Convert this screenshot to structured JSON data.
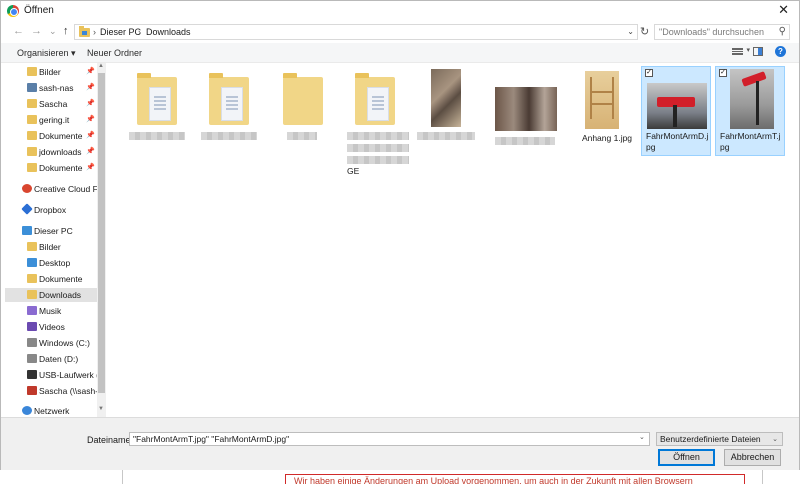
{
  "window": {
    "title": "Öffnen",
    "close_label": "✕"
  },
  "nav": {
    "back": "←",
    "forward": "→",
    "recent": "⌄",
    "up": "↑",
    "breadcrumb": [
      "Dieser PC",
      "Downloads"
    ],
    "separator": "›",
    "search_placeholder": "\"Downloads\" durchsuchen"
  },
  "toolbar": {
    "organize": "Organisieren ▾",
    "new_folder": "Neuer Ordner",
    "help": "?"
  },
  "sidebar": {
    "items": [
      {
        "label": "Bilder",
        "icon": "folder-icon",
        "pinned": true
      },
      {
        "label": "sash-nas",
        "icon": "network-icon",
        "pinned": true
      },
      {
        "label": "Sascha",
        "icon": "folder-icon",
        "pinned": true
      },
      {
        "label": "gering.it",
        "icon": "folder-icon",
        "pinned": true
      },
      {
        "label": "Dokumente",
        "icon": "folder-icon",
        "pinned": true
      },
      {
        "label": "jdownloads",
        "icon": "folder-icon",
        "pinned": true
      },
      {
        "label": "Dokumente",
        "icon": "folder-icon",
        "pinned": true
      },
      {
        "label": "Creative Cloud Fil",
        "icon": "creative-cloud-icon",
        "pinned": false
      },
      {
        "label": "Dropbox",
        "icon": "dropbox-icon",
        "pinned": false
      },
      {
        "label": "Dieser PC",
        "icon": "pc-icon",
        "pinned": false
      },
      {
        "label": "Bilder",
        "icon": "folder-icon",
        "pinned": false
      },
      {
        "label": "Desktop",
        "icon": "folder-icon",
        "pinned": false
      },
      {
        "label": "Dokumente",
        "icon": "folder-icon",
        "pinned": false
      },
      {
        "label": "Downloads",
        "icon": "download-icon",
        "pinned": false,
        "selected": true
      },
      {
        "label": "Musik",
        "icon": "music-icon",
        "pinned": false
      },
      {
        "label": "Videos",
        "icon": "video-icon",
        "pinned": false
      },
      {
        "label": "Windows (C:)",
        "icon": "drive-icon",
        "pinned": false
      },
      {
        "label": "Daten (D:)",
        "icon": "drive-icon",
        "pinned": false
      },
      {
        "label": "USB-Laufwerk (E",
        "icon": "usb-icon",
        "pinned": false
      },
      {
        "label": "Sascha (\\\\sash-n",
        "icon": "network-drive-icon",
        "pinned": false
      },
      {
        "label": "Netzwerk",
        "icon": "network-icon",
        "pinned": false
      }
    ]
  },
  "files": [
    {
      "name": "",
      "kind": "folder"
    },
    {
      "name": "",
      "kind": "folder"
    },
    {
      "name": "",
      "kind": "folder"
    },
    {
      "name": "GE",
      "kind": "folder"
    },
    {
      "name": "",
      "kind": "photo"
    },
    {
      "name": "",
      "kind": "photo"
    },
    {
      "name": "Anhang 1.jpg",
      "kind": "photo"
    },
    {
      "name": "FahrMontArmD.jpg",
      "kind": "photo",
      "selected": true
    },
    {
      "name": "FahrMontArmT.jpg",
      "kind": "photo",
      "selected": true
    }
  ],
  "footer": {
    "filename_label": "Dateiname:",
    "filename_value": "\"FahrMontArmT.jpg\" \"FahrMontArmD.jpg\"",
    "filetype": "Benutzerdefinierte Dateien",
    "open_label": "Öffnen",
    "cancel_label": "Abbrechen"
  },
  "background_page": {
    "notice": "Wir haben einige Änderungen am Upload vorgenommen, um auch in der Zukunft mit allen Browsern"
  },
  "colors": {
    "accent": "#0078d7",
    "selection": "#cce8ff",
    "notice": "#c0392b"
  }
}
